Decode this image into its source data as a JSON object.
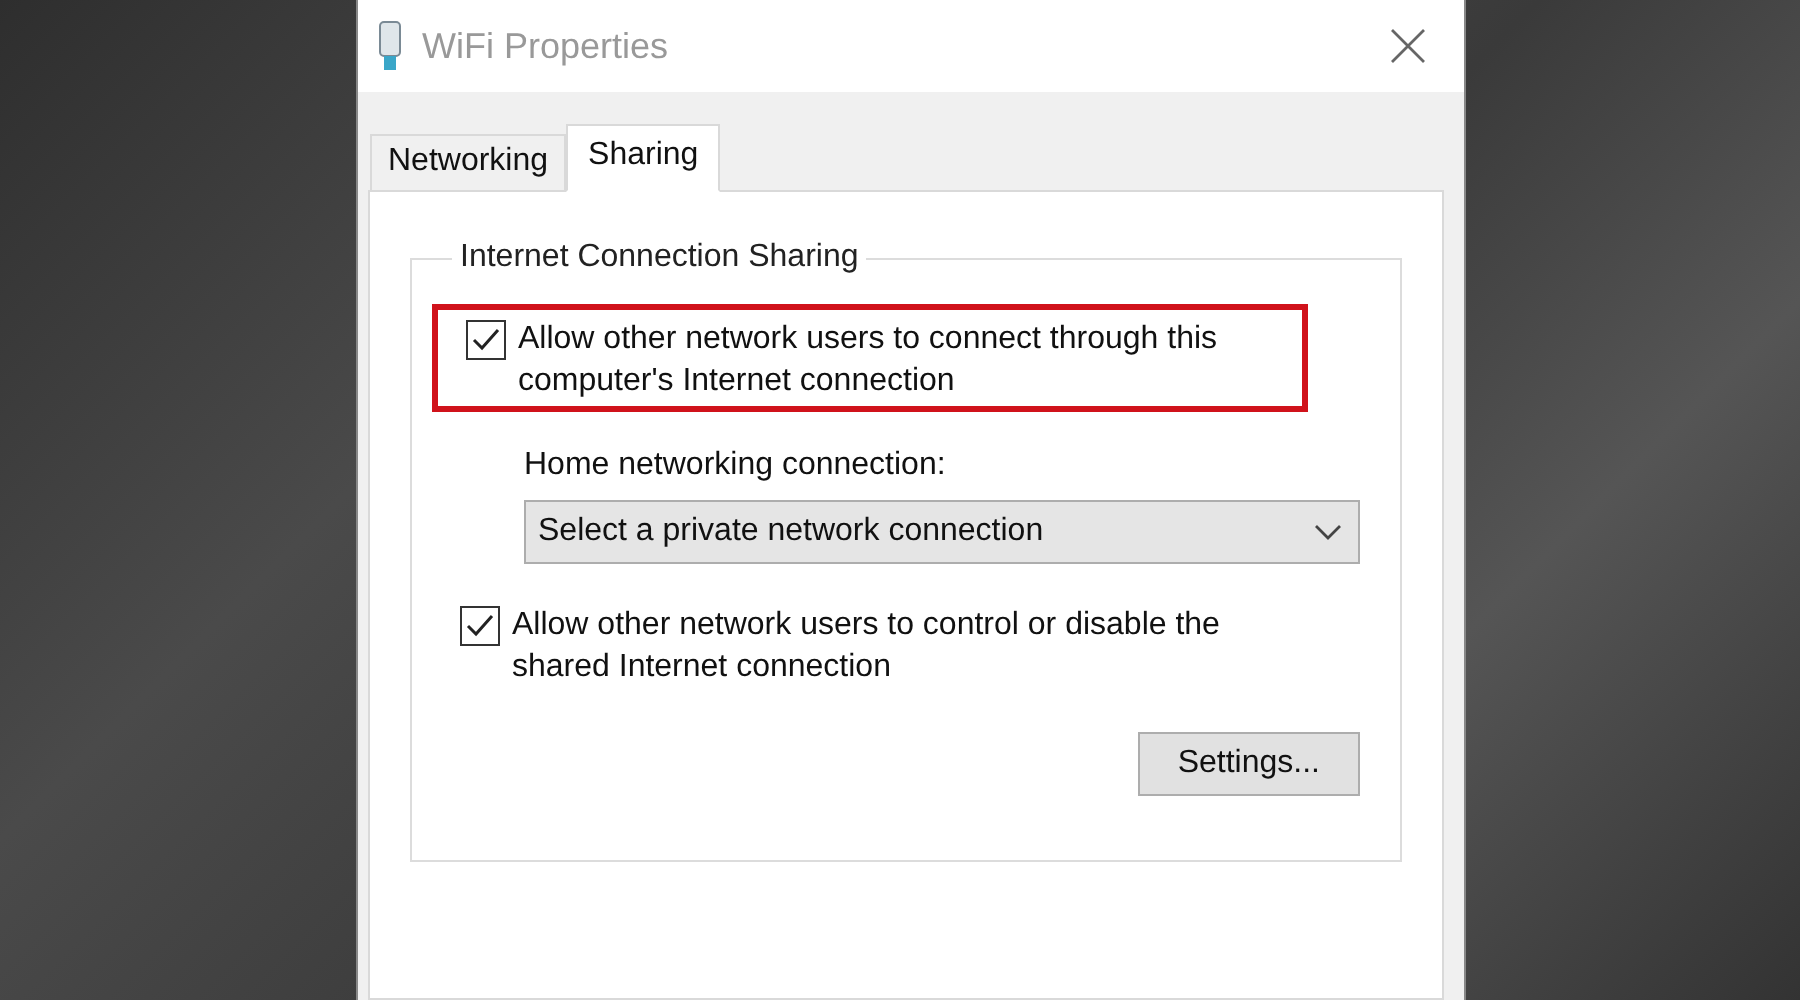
{
  "window": {
    "title": "WiFi Properties"
  },
  "tabs": [
    {
      "label": "Networking",
      "selected": false
    },
    {
      "label": "Sharing",
      "selected": true
    }
  ],
  "group": {
    "title": "Internet Connection Sharing",
    "options": [
      {
        "kind": "checkbox",
        "label": "Allow other network users to connect through this computer's Internet connection",
        "checked": true,
        "highlighted": true
      },
      {
        "kind": "select",
        "label": "Home networking connection:",
        "value": "Select a private network connection"
      },
      {
        "kind": "checkbox",
        "label": "Allow other network users to control or disable the shared Internet connection",
        "checked": true,
        "highlighted": false
      }
    ],
    "button": "Settings..."
  }
}
